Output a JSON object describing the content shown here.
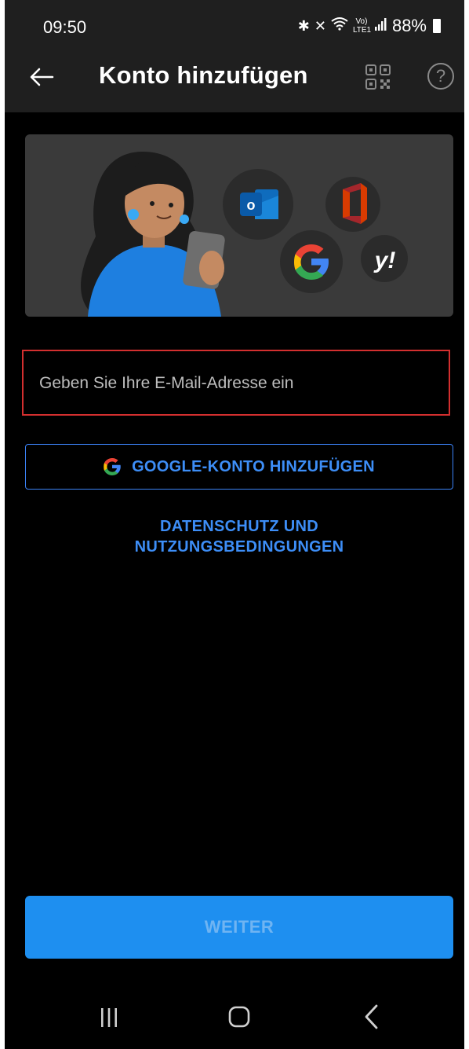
{
  "status_bar": {
    "time": "09:50",
    "network_label": "Vo) LTE1",
    "battery": "88%",
    "icons": [
      "bluetooth-icon",
      "mute-icon",
      "wifi-icon",
      "signal-icon",
      "battery-icon"
    ]
  },
  "app_bar": {
    "title": "Konto hinzufügen",
    "back_icon": "arrow-left-icon",
    "qr_icon": "qr-code-icon",
    "help_icon": "help-icon",
    "help_glyph": "?"
  },
  "hero": {
    "providers": [
      "outlook-icon",
      "office-icon",
      "google-icon",
      "yahoo-icon"
    ],
    "outlook_letter": "o",
    "yahoo_text": "y!"
  },
  "email_field": {
    "placeholder": "Geben Sie Ihre E-Mail-Adresse ein",
    "value": ""
  },
  "google_button": {
    "label": "GOOGLE-KONTO HINZUFÜGEN",
    "icon": "google-g-icon"
  },
  "privacy_link": {
    "line1": "DATENSCHUTZ UND",
    "line2": "NUTZUNGSBEDINGUNGEN"
  },
  "continue_button": {
    "label": "WEITER"
  },
  "nav_bar": {
    "items": [
      "recents-icon",
      "home-icon",
      "back-icon"
    ]
  },
  "colors": {
    "background": "#000000",
    "app_bar": "#1f1f1f",
    "accent": "#3d8ef7",
    "primary_button": "#1e8ff0",
    "error_border": "#d32f2f",
    "hero_card": "#3a3a3a"
  }
}
